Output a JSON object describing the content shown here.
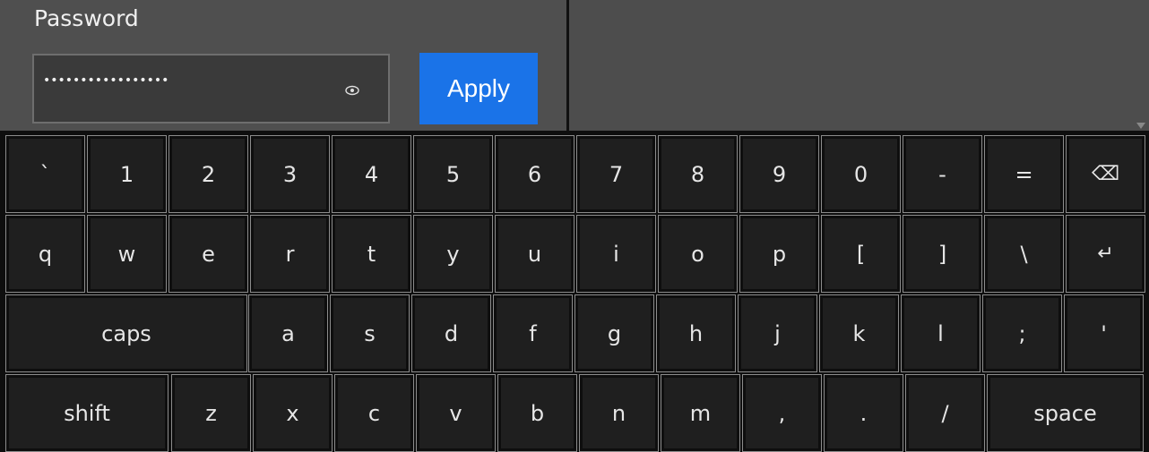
{
  "form": {
    "password_label": "Password",
    "password_value": "•••••••••••••••••",
    "apply_label": "Apply"
  },
  "keyboard": {
    "row1": [
      "`",
      "1",
      "2",
      "3",
      "4",
      "5",
      "6",
      "7",
      "8",
      "9",
      "0",
      "-",
      "=",
      "⌫"
    ],
    "row2": [
      "q",
      "w",
      "e",
      "r",
      "t",
      "y",
      "u",
      "i",
      "o",
      "p",
      "[",
      "]",
      "\\",
      "↵"
    ],
    "row3": [
      "caps",
      "a",
      "s",
      "d",
      "f",
      "g",
      "h",
      "j",
      "k",
      "l",
      ";",
      "'"
    ],
    "row4": [
      "shift",
      "z",
      "x",
      "c",
      "v",
      "b",
      "n",
      "m",
      ",",
      ".",
      "/",
      "space"
    ]
  },
  "colors": {
    "apply_bg": "#1a73e8",
    "panel_bg": "#4f4f4f",
    "key_bg": "#1f1f1f"
  }
}
